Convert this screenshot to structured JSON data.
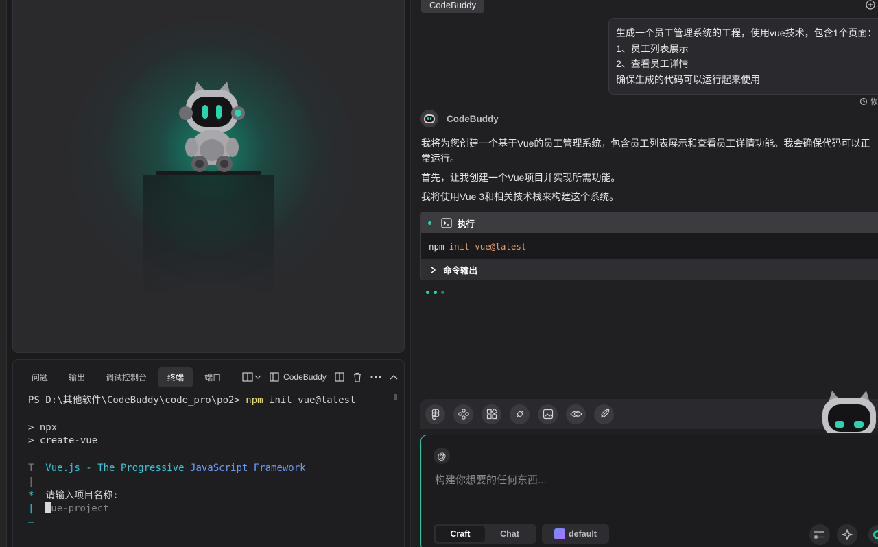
{
  "preview": {
    "robot_icon": "codebuddy-robot-mascot"
  },
  "terminal": {
    "tabs": [
      {
        "label": "问题"
      },
      {
        "label": "输出"
      },
      {
        "label": "调试控制台"
      },
      {
        "label": "终端"
      },
      {
        "label": "端口"
      }
    ],
    "active_tab": "终端",
    "instance_label": "CodeBuddy",
    "lines": {
      "prompt": "PS D:\\其他软件\\CodeBuddy\\code_pro\\po2> ",
      "cmd_npm": "npm",
      "cmd_rest": " init vue@latest",
      "npx": "> npx",
      "create_vue": "> create-vue",
      "banner_prefix": "T  ",
      "banner_vuejs": "Vue.js - The Progressive ",
      "banner_framework": "JavaScript Framework",
      "pipe1": "|",
      "question_star": "*  ",
      "question_text": "请输入项目名称:",
      "answer_pipe": "|  ",
      "answer_cursor_char": "v",
      "answer_default": "ue-project",
      "end_mark": "—"
    }
  },
  "chat": {
    "top_tag": "CodeBuddy",
    "user_message": [
      "生成一个员工管理系统的工程，使用vue技术，包含1个页面：",
      "1、员工列表展示",
      "2、查看员工详情",
      "确保生成的代码可以运行起来使用"
    ],
    "undo_label": "恢",
    "assistant_name": "CodeBuddy",
    "assistant_paragraphs": [
      "我将为您创建一个基于Vue的员工管理系统，包含员工列表展示和查看员工详情功能。我会确保代码可以正常运行。",
      "首先，让我创建一个Vue项目并实现所需功能。",
      "我将使用Vue 3和相关技术栈来构建这个系统。"
    ],
    "exec_card": {
      "title": "执行",
      "command": "npm",
      "command_args": "init vue@latest",
      "output_label": "命令输出"
    },
    "toolbar_icons": [
      "figma-icon",
      "components-icon",
      "blocks-icon",
      "api-icon",
      "image-icon",
      "preview-eye-icon",
      "deploy-rocket-icon"
    ],
    "input": {
      "placeholder": "构建你想要的任何东西...",
      "modes": [
        "Craft",
        "Chat"
      ],
      "active_mode": "Craft",
      "model": "default"
    }
  },
  "colors": {
    "accent": "#27d6b1",
    "terminal_yellow": "#e8e07a",
    "terminal_cyan": "#2fc7d6",
    "terminal_blue": "#6b9cf5",
    "arg_orange": "#e6a06a"
  }
}
